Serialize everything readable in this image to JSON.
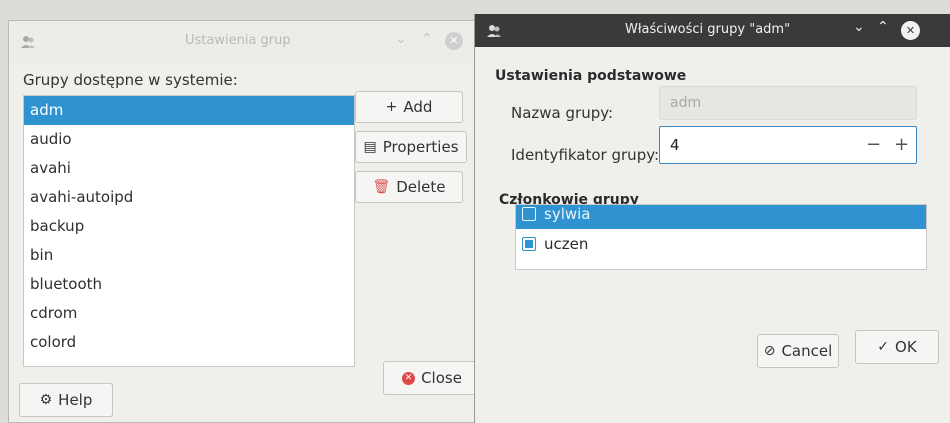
{
  "left_window": {
    "title": "Ustawienia grup",
    "available_label": "Grupy dostępne w systemie:",
    "groups": [
      "adm",
      "audio",
      "avahi",
      "avahi-autoipd",
      "backup",
      "bin",
      "bluetooth",
      "cdrom",
      "colord"
    ],
    "selected_group": "adm",
    "buttons": {
      "add": "Add",
      "properties": "Properties",
      "delete": "Delete",
      "close": "Close",
      "help": "Help"
    }
  },
  "right_window": {
    "title": "Właściwości grupy \"adm\"",
    "basic_section": "Ustawienia podstawowe",
    "name_label": "Nazwa grupy:",
    "name_value": "adm",
    "id_label": "Identyfikator grupy:",
    "id_value": "4",
    "members_section": "Członkowie grupy",
    "members": [
      {
        "name": "sylwia",
        "checked": false,
        "selected": true
      },
      {
        "name": "uczen",
        "checked": true,
        "selected": false
      }
    ],
    "buttons": {
      "cancel": "Cancel",
      "ok": "OK"
    }
  },
  "colors": {
    "selection": "#2f93d1",
    "titlebar_dark": "#3a3a3a",
    "close_button": "#e04848"
  },
  "icons": [
    "users-icon",
    "minimize-icon",
    "maximize-icon",
    "close-icon",
    "add-icon",
    "properties-icon",
    "trash-icon",
    "help-icon",
    "cancel-icon",
    "check-icon"
  ]
}
